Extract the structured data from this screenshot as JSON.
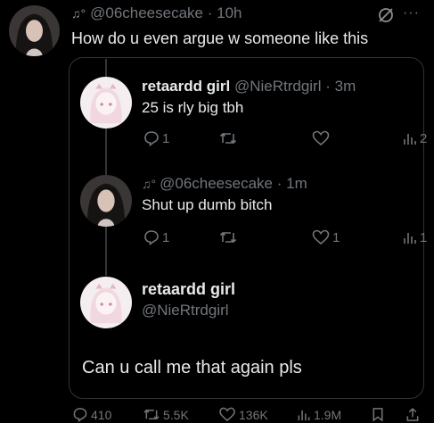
{
  "main_tweet": {
    "glyph": "♫°",
    "handle": "@06cheesecake",
    "time": "10h",
    "text": "How do u even argue w someone like this",
    "more_label": "···"
  },
  "replies": [
    {
      "display_name": "retaardd girl",
      "handle": "@NieRtrdgirl",
      "time": "3m",
      "text": "25 is rly big tbh",
      "reply_count": "1",
      "retweet_count": "",
      "like_count": "",
      "views": "2"
    },
    {
      "glyph": "♫°",
      "handle": "@06cheesecake",
      "time": "1m",
      "text": "Shut up dumb bitch",
      "reply_count": "1",
      "retweet_count": "",
      "like_count": "1",
      "views": "1"
    }
  ],
  "profile": {
    "display_name": "retaardd girl",
    "handle": "@NieRtrdgirl"
  },
  "final_message": "Can u call me that again pls",
  "bottom_actions": {
    "replies": "410",
    "retweets": "5.5K",
    "likes": "136K",
    "views": "1.9M"
  },
  "colors": {
    "background": "#000000",
    "text": "#e7e9ea",
    "muted": "#71767b",
    "border": "#2f3336"
  },
  "icons": [
    "grok-icon",
    "more-icon",
    "reply-icon",
    "retweet-icon",
    "like-icon",
    "views-icon",
    "bookmark-icon",
    "share-icon"
  ]
}
